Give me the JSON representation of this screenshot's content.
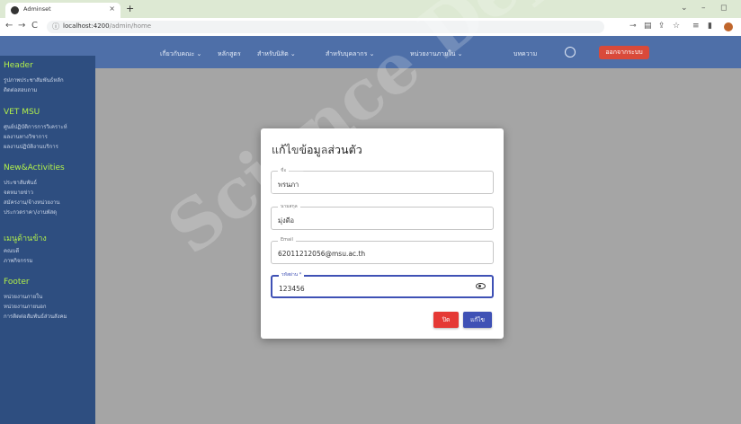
{
  "browser": {
    "tab_title": "Adminset",
    "new_tab": "+",
    "tab_close": "×",
    "url_host": "localhost:4200",
    "url_path": "/admin/home",
    "nav": {
      "back": "←",
      "forward": "→",
      "reload": "C"
    },
    "window": {
      "minimize": "–",
      "maximize": "◻",
      "collapse": "⌄"
    }
  },
  "navbar": {
    "items": [
      {
        "label": "เกี่ยวกับคณะ ⌄"
      },
      {
        "label": "หลักสูตร"
      },
      {
        "label": "สำหรับนิสิต ⌄"
      },
      {
        "label": "สำหรับบุคลากร ⌄"
      },
      {
        "label": "หน่วยงานภายใน ⌄"
      },
      {
        "label": "บทความ"
      }
    ],
    "logout_label": "ออกจากระบบ"
  },
  "sidebar": {
    "sections": [
      {
        "heading": "Header",
        "links": [
          "รูปภาพประชาสัมพันธ์หลัก",
          "ติดต่อสอบถาม"
        ]
      },
      {
        "heading": "VET MSU",
        "links": [
          "ศูนย์ปฏิบัติการการวิเคราะห์",
          "ผลงานทางวิชาการ",
          "ผลงานปฏิบัติงานบริการ"
        ]
      },
      {
        "heading": "New&Activities",
        "links": [
          "ประชาสัมพันธ์",
          "จดหมายข่าว",
          "สมัครงาน/จ้างหน่วยงาน",
          "ประกวดราคา/งานพัสดุ"
        ]
      },
      {
        "heading": "เมนูด้านข้าง",
        "links": [
          "คณบดี",
          "ภาพกิจกรรม"
        ]
      },
      {
        "heading": "Footer",
        "links": [
          "หน่วยงานภายใน",
          "หน่วยงานภายนอก",
          "การติดต่อสัมพันธ์ส่วนสังคม"
        ]
      }
    ]
  },
  "modal": {
    "title": "แก้ไขข้อมูลส่วนตัว",
    "fields": [
      {
        "label": "ชื่อ",
        "value": "พรนภา"
      },
      {
        "label": "นามสกุล",
        "value": "มุ่งดีอ"
      },
      {
        "label": "Email",
        "value": "62011212056@msu.ac.th"
      },
      {
        "label": "รหัสผ่าน *",
        "value": "123456"
      }
    ],
    "cancel_label": "ปิด",
    "save_label": "แก้ไข"
  },
  "watermark": "Science Depa… Mahasarakham"
}
